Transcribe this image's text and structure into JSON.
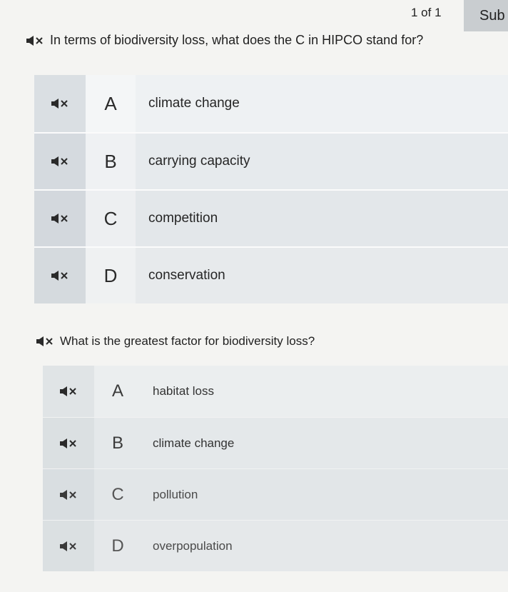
{
  "header": {
    "page_count": "1 of 1",
    "submit_label": "Sub"
  },
  "questions": [
    {
      "text": "In terms of biodiversity loss, what does the C in HIPCO stand for?",
      "options": [
        {
          "letter": "A",
          "text": "climate change"
        },
        {
          "letter": "B",
          "text": "carrying capacity"
        },
        {
          "letter": "C",
          "text": "competition"
        },
        {
          "letter": "D",
          "text": "conservation"
        }
      ]
    },
    {
      "text": "What is the greatest factor for biodiversity loss?",
      "options": [
        {
          "letter": "A",
          "text": "habitat loss"
        },
        {
          "letter": "B",
          "text": "climate change"
        },
        {
          "letter": "C",
          "text": "pollution"
        },
        {
          "letter": "D",
          "text": "overpopulation"
        }
      ]
    }
  ],
  "icons": {
    "speaker": "speaker-muted-icon"
  }
}
